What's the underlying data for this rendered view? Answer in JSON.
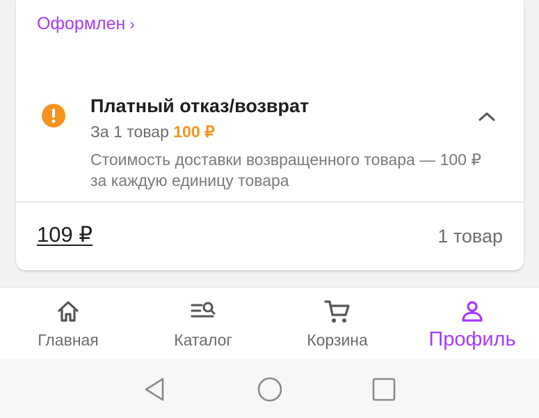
{
  "order": {
    "status_link": "Оформлен",
    "status_chevron": "›"
  },
  "refund": {
    "icon": "exclamation-circle-icon",
    "title": "Платный отказ/возврат",
    "per_item_prefix": "За 1 товар",
    "per_item_price": "100 ₽",
    "description": "Стоимость доставки возвращенного товара — 100 ₽ за каждую единицу товара",
    "collapse_icon": "chevron-up-icon"
  },
  "summary": {
    "total": "109 ₽",
    "items_count": "1 товар"
  },
  "nav": {
    "items": [
      {
        "label": "Главная",
        "icon": "home-icon",
        "active": false
      },
      {
        "label": "Каталог",
        "icon": "catalog-search-icon",
        "active": false
      },
      {
        "label": "Корзина",
        "icon": "cart-icon",
        "active": false
      },
      {
        "label": "Профиль",
        "icon": "profile-icon",
        "active": true
      }
    ]
  },
  "colors": {
    "accent": "#a73afd",
    "warning": "#f7931e",
    "text_primary": "#1f1f1f",
    "text_secondary": "#6c6c6c"
  }
}
